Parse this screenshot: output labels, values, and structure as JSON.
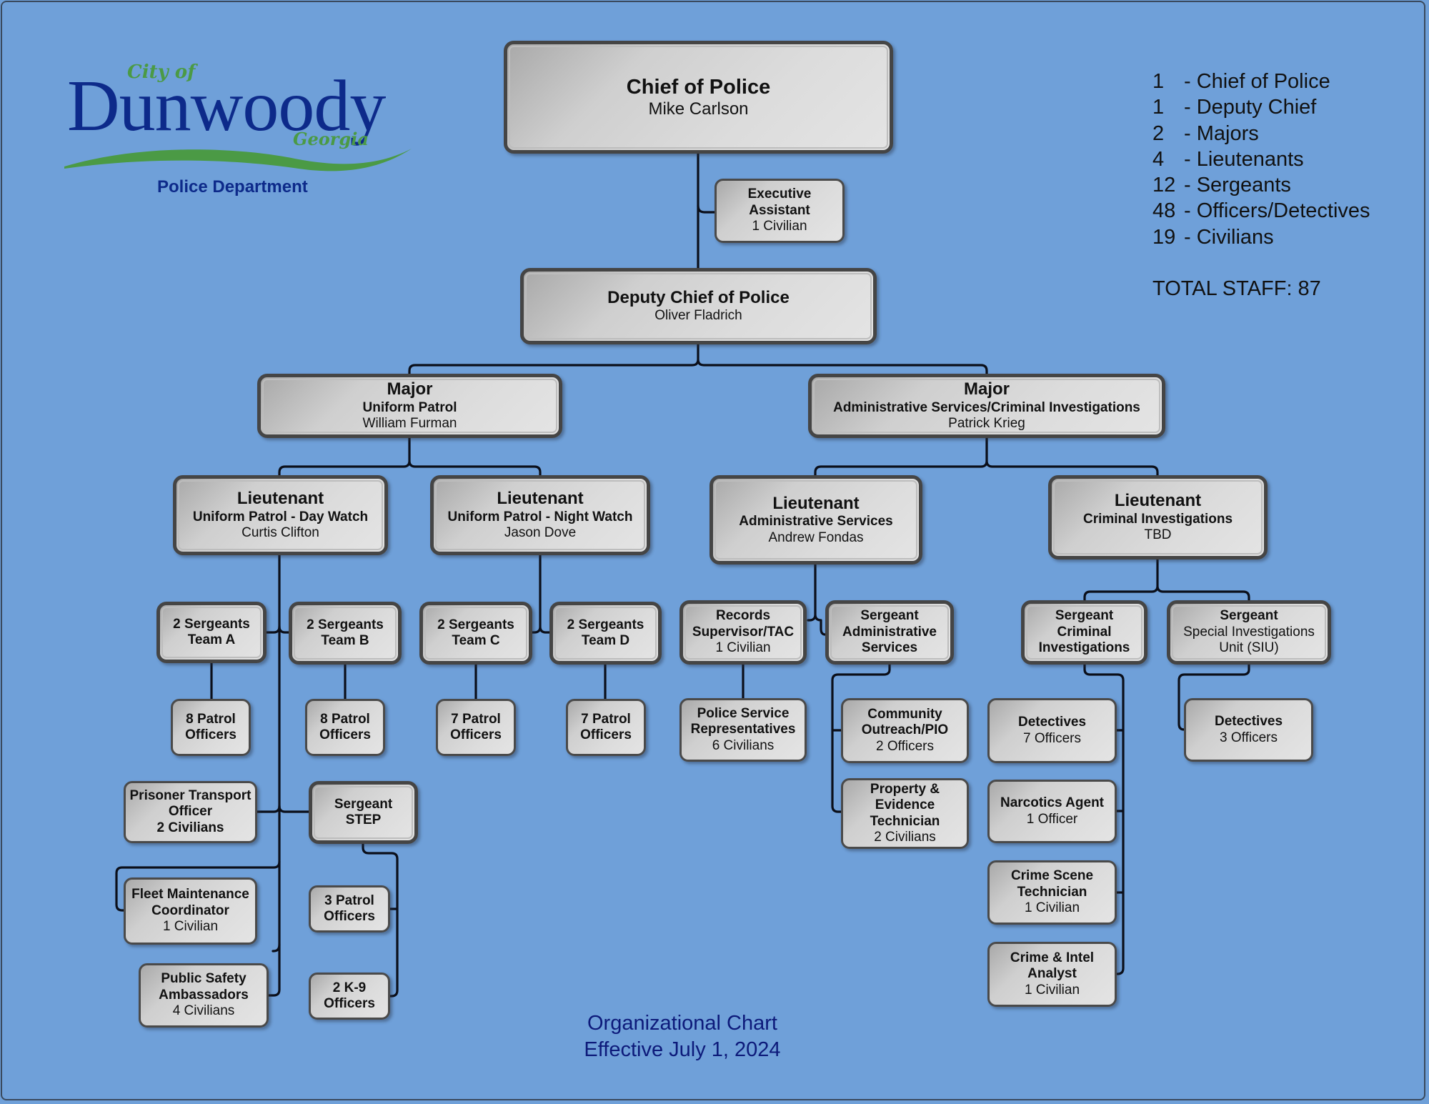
{
  "logo": {
    "prefix": "City of",
    "name": "Dunwoody",
    "state": "Georgia",
    "department": "Police Department",
    "colors": {
      "name": "#0d2a8a",
      "accent": "#4b9a45"
    }
  },
  "legend": {
    "rows": [
      {
        "count": "1",
        "label": "- Chief of Police"
      },
      {
        "count": "1",
        "label": "- Deputy Chief"
      },
      {
        "count": "2",
        "label": "- Majors"
      },
      {
        "count": "4",
        "label": "- Lieutenants"
      },
      {
        "count": "12",
        "label": "- Sergeants"
      },
      {
        "count": "48",
        "label": "- Officers/Detectives"
      },
      {
        "count": "19",
        "label": "- Civilians"
      }
    ],
    "total": "TOTAL STAFF: 87"
  },
  "footer": {
    "line1": "Organizational Chart",
    "line2": "Effective July 1, 2024"
  },
  "nodes": {
    "chief": {
      "title": "Chief of Police",
      "name": "Mike Carlson"
    },
    "exec_assistant": {
      "title": "Executive Assistant",
      "staff": "1 Civilian"
    },
    "deputy": {
      "title": "Deputy Chief of Police",
      "name": "Oliver Fladrich"
    },
    "major_up": {
      "title": "Major",
      "unit": "Uniform Patrol",
      "name": "William Furman"
    },
    "major_as": {
      "title": "Major",
      "unit": "Administrative Services/Criminal Investigations",
      "name": "Patrick Krieg"
    },
    "lt_day": {
      "title": "Lieutenant",
      "unit": "Uniform Patrol - Day Watch",
      "name": "Curtis Clifton"
    },
    "lt_night": {
      "title": "Lieutenant",
      "unit": "Uniform Patrol - Night Watch",
      "name": "Jason Dove"
    },
    "lt_admin": {
      "title": "Lieutenant",
      "unit": "Administrative Services",
      "name": "Andrew Fondas"
    },
    "lt_ci": {
      "title": "Lieutenant",
      "unit": "Criminal Investigations",
      "name": "TBD"
    },
    "sgt_a": {
      "line1": "2 Sergeants",
      "line2": "Team A"
    },
    "sgt_b": {
      "line1": "2 Sergeants",
      "line2": "Team B"
    },
    "sgt_c": {
      "line1": "2 Sergeants",
      "line2": "Team C"
    },
    "sgt_d": {
      "line1": "2 Sergeants",
      "line2": "Team D"
    },
    "po_a": {
      "line1": "8 Patrol",
      "line2": "Officers"
    },
    "po_b": {
      "line1": "8 Patrol",
      "line2": "Officers"
    },
    "po_c": {
      "line1": "7 Patrol",
      "line2": "Officers"
    },
    "po_d": {
      "line1": "7 Patrol",
      "line2": "Officers"
    },
    "prisoner": {
      "line1": "Prisoner Transport",
      "line2": "Officer",
      "line3": "2 Civilians"
    },
    "sgt_step": {
      "line1": "Sergeant",
      "line2": "STEP"
    },
    "fleet": {
      "line1": "Fleet Maintenance",
      "line2": "Coordinator",
      "staff": "1 Civilian"
    },
    "psa": {
      "line1": "Public Safety",
      "line2": "Ambassadors",
      "staff": "4 Civilians"
    },
    "step_po": {
      "line1": "3 Patrol",
      "line2": "Officers"
    },
    "step_k9": {
      "line1": "2 K-9",
      "line2": "Officers"
    },
    "records": {
      "line1": "Records",
      "line2": "Supervisor/TAC",
      "staff": "1 Civilian"
    },
    "sgt_admin": {
      "line1": "Sergeant",
      "line2": "Administrative",
      "line3": "Services"
    },
    "psr": {
      "line1": "Police Service",
      "line2": "Representatives",
      "staff": "6 Civilians"
    },
    "community": {
      "line1": "Community",
      "line2": "Outreach/PIO",
      "staff": "2 Officers"
    },
    "property": {
      "line1": "Property &",
      "line2": "Evidence",
      "line3": "Technician",
      "staff": "2 Civilians"
    },
    "sgt_ci": {
      "line1": "Sergeant",
      "line2": "Criminal",
      "line3": "Investigations"
    },
    "sgt_siu": {
      "line1": "Sergeant",
      "line2": "Special Investigations",
      "line3": "Unit (SIU)"
    },
    "det_ci": {
      "title": "Detectives",
      "staff": "7 Officers"
    },
    "narcotics": {
      "title": "Narcotics Agent",
      "staff": "1 Officer"
    },
    "cst": {
      "line1": "Crime Scene",
      "line2": "Technician",
      "staff": "1 Civilian"
    },
    "cia": {
      "line1": "Crime & Intel",
      "line2": "Analyst",
      "staff": "1 Civilian"
    },
    "det_siu": {
      "title": "Detectives",
      "staff": "3 Officers"
    }
  }
}
